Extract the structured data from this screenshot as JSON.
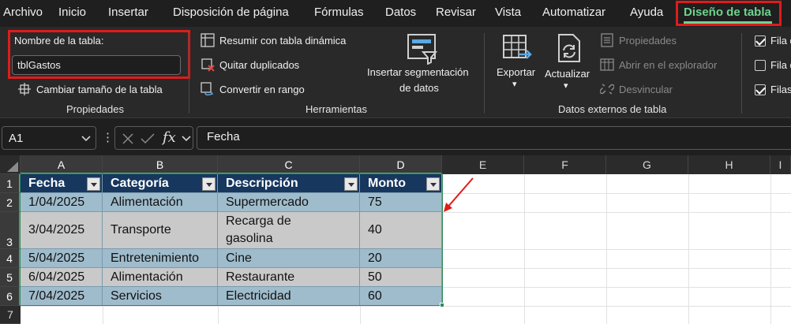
{
  "menu": {
    "items": [
      "Archivo",
      "Inicio",
      "Insertar",
      "Disposición de página",
      "Fórmulas",
      "Datos",
      "Revisar",
      "Vista",
      "Automatizar",
      "Ayuda"
    ],
    "active": "Diseño de tabla"
  },
  "ribbon": {
    "propiedades": {
      "name_label": "Nombre de la tabla:",
      "name_value": "tblGastos",
      "resize": "Cambiar tamaño de la tabla",
      "group": "Propiedades"
    },
    "herramientas": {
      "pivot": "Resumir con tabla dinámica",
      "dupes": "Quitar duplicados",
      "range": "Convertir en rango",
      "slicer_line1": "Insertar segmentación",
      "slicer_line2": "de datos",
      "group": "Herramientas"
    },
    "externos": {
      "export": "Exportar",
      "refresh": "Actualizar",
      "props": "Propiedades",
      "browser": "Abrir en el explorador",
      "unlink": "Desvincular",
      "group": "Datos externos de tabla"
    },
    "estilo": {
      "opt1": "Fila d",
      "opt2": "Fila d",
      "opt3": "Filas"
    }
  },
  "formula": {
    "cell_ref": "A1",
    "value": "Fecha"
  },
  "sheet": {
    "columns": [
      "A",
      "B",
      "C",
      "D",
      "E",
      "F",
      "G",
      "H",
      "I"
    ],
    "rows": [
      "1",
      "2",
      "3",
      "4",
      "5",
      "6",
      "7"
    ],
    "headers": [
      "Fecha",
      "Categoría",
      "Descripción",
      "Monto"
    ],
    "data": [
      [
        "1/04/2025",
        "Alimentación",
        "Supermercado",
        "75"
      ],
      [
        "3/04/2025",
        "Transporte",
        "Recarga de gasolina",
        "40"
      ],
      [
        "5/04/2025",
        "Entretenimiento",
        "Cine",
        "20"
      ],
      [
        "6/04/2025",
        "Alimentación",
        "Restaurante",
        "50"
      ],
      [
        "7/04/2025",
        "Servicios",
        "Electricidad",
        "60"
      ]
    ]
  },
  "colors": {
    "accent": "#6fd38f",
    "highlight": "#e01b1b",
    "table_header": "#17375e",
    "band_a": "#9fbccc",
    "band_b": "#c9c9c9"
  }
}
